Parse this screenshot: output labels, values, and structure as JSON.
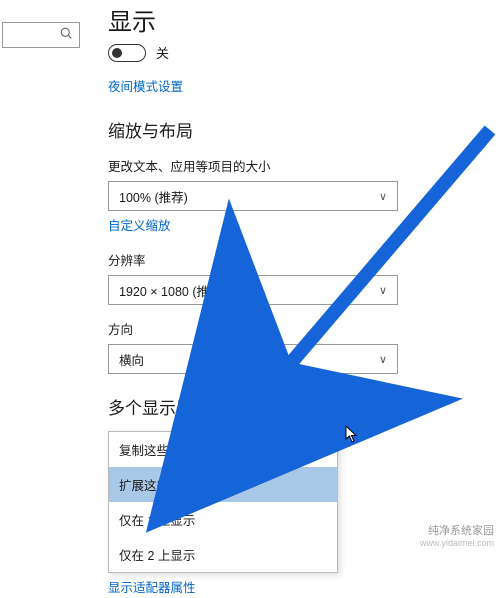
{
  "searchbox": {
    "placeholder": ""
  },
  "display": {
    "heading": "显示",
    "toggle_label": "关",
    "night_mode_link": "夜间模式设置"
  },
  "scale": {
    "heading": "缩放与布局",
    "text_size_label": "更改文本、应用等项目的大小",
    "text_size_value": "100% (推荐)",
    "custom_scale_link": "自定义缩放",
    "resolution_label": "分辨率",
    "resolution_value": "1920 × 1080 (推荐)",
    "orientation_label": "方向",
    "orientation_value": "横向"
  },
  "multi": {
    "heading": "多个显示器",
    "options": [
      "复制这些显示器",
      "扩展这些显示器",
      "仅在 1 上显示",
      "仅在 2 上显示"
    ],
    "selected_index": 1,
    "adapter_link": "显示适配器属性"
  },
  "watermark": {
    "brand": "纯净系统家园",
    "host": "www.yidaimei.com"
  }
}
